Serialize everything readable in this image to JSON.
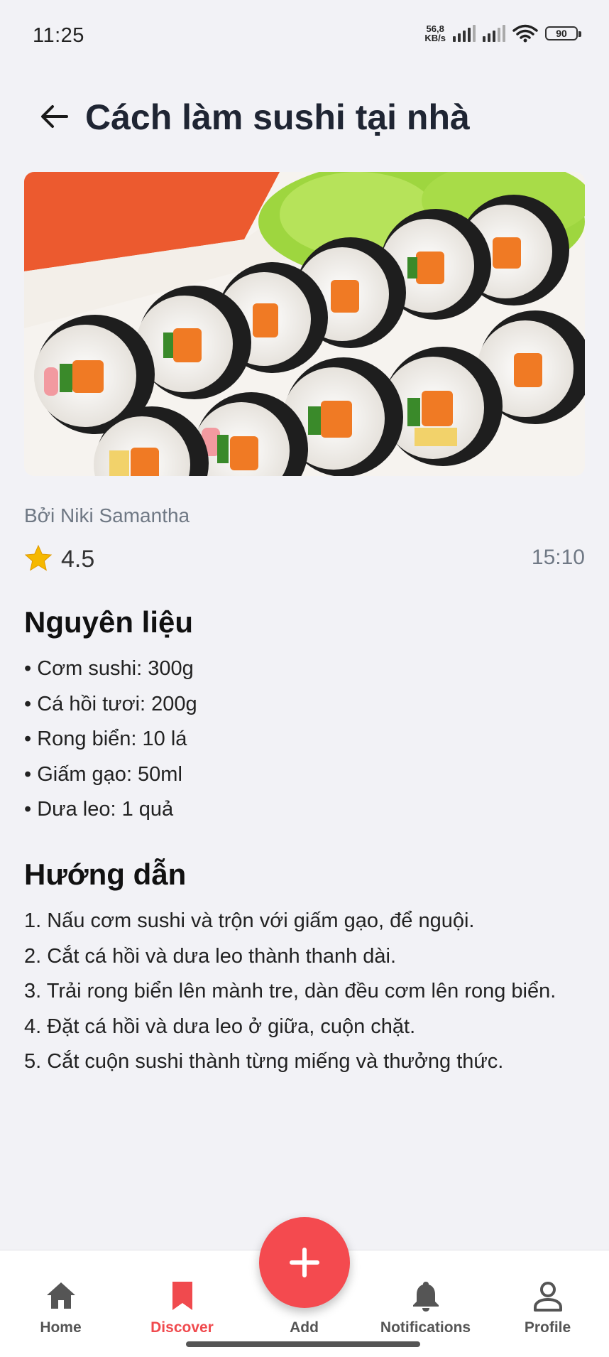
{
  "status_bar": {
    "time": "11:25",
    "net_speed_value": "56,8",
    "net_speed_unit": "KB/s",
    "battery": "90"
  },
  "header": {
    "title": "Cách làm sushi tại nhà",
    "back_icon": "arrow-left-icon"
  },
  "recipe": {
    "image": "sushi-rolls-photo",
    "author": "Bởi Niki Samantha",
    "rating": "4.5",
    "time": "15:10"
  },
  "ingredients": {
    "title": "Nguyên liệu",
    "items": [
      "• Cơm sushi: 300g",
      "• Cá hồi tươi: 200g",
      "• Rong biển: 10 lá",
      "• Giấm gạo: 50ml",
      "• Dưa leo: 1 quả"
    ]
  },
  "instructions": {
    "title": "Hướng dẫn",
    "steps": [
      "1. Nấu cơm sushi và trộn với giấm gạo, để nguội.",
      "2. Cắt cá hồi và dưa leo thành thanh dài.",
      "3. Trải rong biển lên mành tre, dàn đều cơm lên rong biển.",
      "4. Đặt cá hồi và dưa leo ở giữa, cuộn chặt.",
      "5. Cắt cuộn sushi thành từng miếng và thưởng thức."
    ]
  },
  "bottom_nav": {
    "items": [
      {
        "label": "Home",
        "icon": "home-icon"
      },
      {
        "label": "Discover",
        "icon": "bookmark-icon",
        "active": true
      },
      {
        "label": "Add",
        "icon": "plus-icon"
      },
      {
        "label": "Notifications",
        "icon": "bell-icon"
      },
      {
        "label": "Profile",
        "icon": "person-icon"
      }
    ]
  },
  "colors": {
    "accent": "#f44a4f",
    "background": "#f2f2f6",
    "title_text": "#1f2533",
    "muted_text": "#6f7884",
    "star": "#f5b800"
  }
}
